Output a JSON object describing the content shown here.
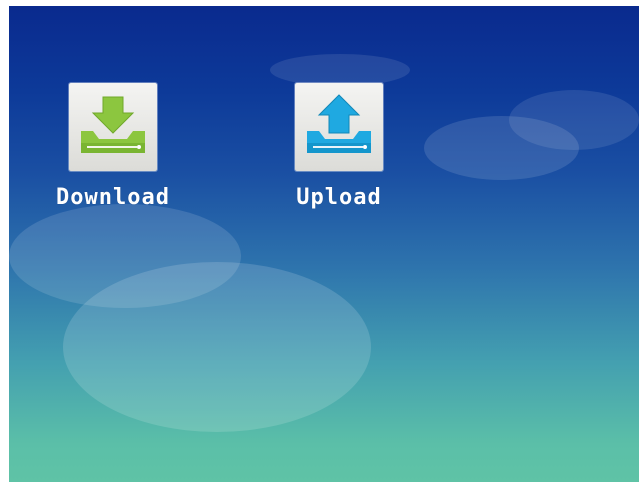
{
  "desktop": {
    "apps": [
      {
        "label": "Download",
        "icon": "download-tray-icon",
        "accent": "#8cc63f"
      },
      {
        "label": "Upload",
        "icon": "upload-tray-icon",
        "accent": "#1fa9e1"
      }
    ]
  }
}
